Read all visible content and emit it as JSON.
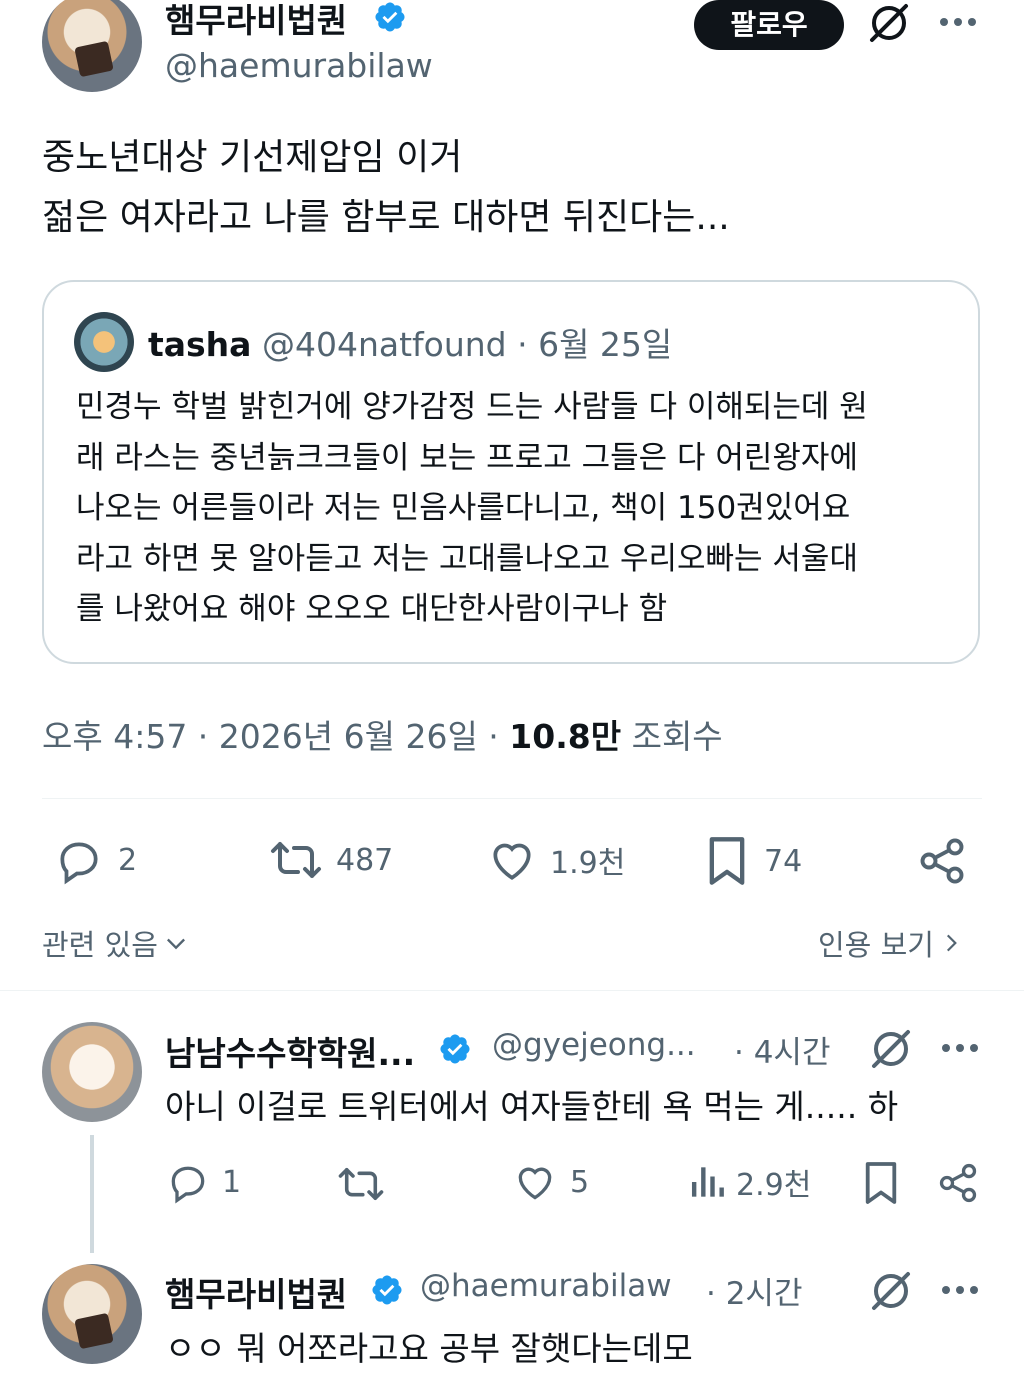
{
  "main_tweet": {
    "author_name": "햄무라비법퀀",
    "author_handle": "@haemurabilaw",
    "follow_label": "팔로우",
    "text_lines": [
      "중노년대상 기선제압임 이거",
      "젊은 여자라고 나를 함부로 대하면 뒤진다는..."
    ],
    "quote": {
      "name": "tasha",
      "handle": "@404natfound",
      "date": "· 6월 25일",
      "text_lines": [
        "민경누 학벌 밝힌거에 양가감정 드는 사람들 다 이해되는데 원",
        "래 라스는 중년늙크크들이 보는 프로고 그들은 다 어린왕자에",
        "나오는 어른들이라 저는 민음사를다니고, 책이 150권있어요",
        "라고 하면 못 알아듣고 저는 고대를나오고 우리오빠는 서울대",
        "를 나왔어요 해야 오오오 대단한사람이구나 함"
      ]
    },
    "timestamp": "오후 4:57 · 2026년 6월 26일 ·",
    "views_count": "10.8만",
    "views_label": "조회수",
    "actions": {
      "replies": "2",
      "retweets": "487",
      "likes": "1.9천",
      "bookmarks": "74"
    },
    "related_label": "관련 있음",
    "quotes_label": "인용 보기"
  },
  "replies": [
    {
      "author_name": "남남수수학학원...",
      "author_handle": "@gyejeong...",
      "time": "· 4시간",
      "text": "아니 이걸로 트위터에서 여자들한테 욕 먹는 게..... 하",
      "actions": {
        "replies": "1",
        "likes": "5",
        "views": "2.9천"
      }
    },
    {
      "author_name": "햄무라비법퀀",
      "author_handle": "@haemurabilaw",
      "time": "· 2시간",
      "text": "ㅇㅇ 뭐 어쪼라고요 공부 잘햇다는데모"
    }
  ],
  "colors": {
    "text": "#0f1419",
    "muted": "#536471",
    "verified": "#1d9bf0",
    "border": "#cfd9de",
    "divider": "#eff3f4"
  },
  "icons": [
    "verified-badge-icon",
    "grok-icon",
    "more-icon",
    "reply-icon",
    "retweet-icon",
    "like-icon",
    "bookmark-icon",
    "share-icon",
    "views-icon",
    "chevron-down-icon",
    "chevron-right-icon"
  ]
}
